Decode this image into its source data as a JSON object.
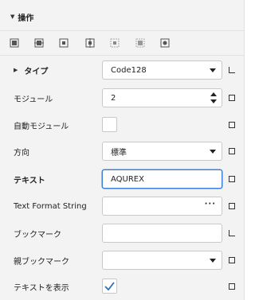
{
  "section": {
    "title": "操作"
  },
  "toolbar": {
    "icons": [
      "align-left-icon",
      "align-center-icon",
      "align-middle-icon",
      "align-right-icon",
      "distribute-horizontal-icon",
      "distribute-vertical-icon",
      "center-icon"
    ]
  },
  "properties": [
    {
      "label": "タイプ",
      "value": "Code128",
      "editor": "dropdown"
    },
    {
      "label": "モジュール",
      "value": "2",
      "editor": "spinner"
    },
    {
      "label": "自動モジュール",
      "value": "",
      "editor": "checkbox",
      "checked": false
    },
    {
      "label": "方向",
      "value": "標準",
      "editor": "dropdown"
    },
    {
      "label": "テキスト",
      "value": "AQUREX",
      "editor": "text"
    },
    {
      "label": "Text Format String",
      "value": "",
      "editor": "ellipsis",
      "button_label": "···"
    },
    {
      "label": "ブックマーク",
      "value": "",
      "editor": "text"
    },
    {
      "label": "親ブックマーク",
      "value": "",
      "editor": "dropdown"
    },
    {
      "label": "テキストを表示",
      "value": "",
      "editor": "checkbox",
      "checked": true
    }
  ],
  "colors": {
    "accent": "#3b82d6",
    "panel": "#f3f3f3",
    "check": "#2f6fb5"
  }
}
